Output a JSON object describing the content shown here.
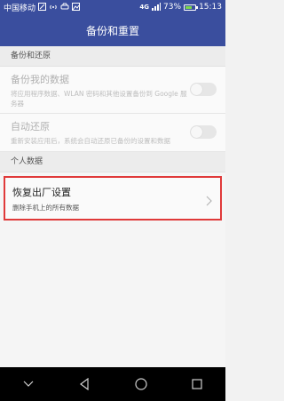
{
  "status_bar": {
    "carrier": "中国移动",
    "network": "4G",
    "battery_percent": "73%",
    "battery_level": 0.73,
    "time": "15:13"
  },
  "app_bar": {
    "title": "备份和重置"
  },
  "backup_section": {
    "header": "备份和还原",
    "backup_my_data": {
      "title": "备份我的数据",
      "subtitle": "将应用程序数据、WLAN 密码和其他设置备份到 Google 服务器",
      "enabled": false
    },
    "auto_restore": {
      "title": "自动还原",
      "subtitle": "重新安装应用后，系统会自动还原已备份的设置和数据",
      "enabled": false
    }
  },
  "personal_section": {
    "header": "个人数据",
    "factory_reset": {
      "title": "恢复出厂设置",
      "subtitle": "删除手机上的所有数据"
    }
  },
  "colors": {
    "primary": "#3a4e9e",
    "highlight_border": "#e03a3a"
  },
  "nav_bar": {
    "icons": [
      "chevron-down-icon",
      "back-icon",
      "home-icon",
      "recents-icon"
    ]
  }
}
